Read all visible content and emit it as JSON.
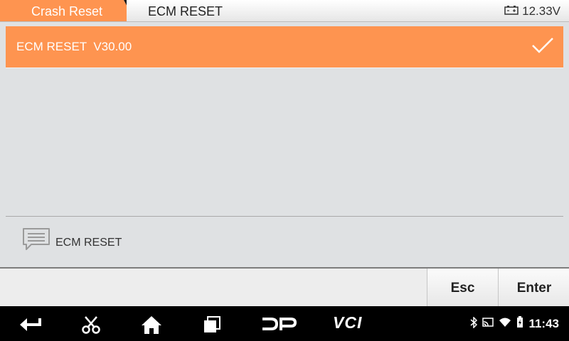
{
  "header": {
    "breadcrumbs": [
      "Crash Reset",
      "ECM RESET"
    ],
    "voltage": "12.33V"
  },
  "list": {
    "items": [
      {
        "label": "ECM RESET  V30.00",
        "selected": true
      }
    ]
  },
  "info": {
    "text": "ECM RESET"
  },
  "commands": {
    "esc": "Esc",
    "enter": "Enter"
  },
  "navbar": {
    "icons": [
      "back-icon",
      "scissors-icon",
      "home-icon",
      "recent-apps-icon",
      "dp-icon",
      "vci-icon"
    ],
    "dp_label": "DP",
    "vci_label": "VCI",
    "status_icons": [
      "bluetooth-icon",
      "cast-icon",
      "wifi-icon",
      "battery-charging-icon"
    ],
    "time": "11:43"
  },
  "colors": {
    "accent": "#fe9450",
    "navbar": "#000000",
    "panel": "#dfe1e3"
  }
}
